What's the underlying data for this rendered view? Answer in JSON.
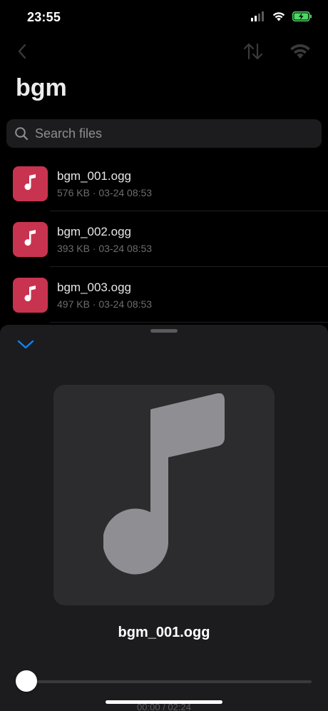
{
  "status_bar": {
    "time": "23:55",
    "icons": [
      "cellular-signal-icon",
      "wifi-icon",
      "battery-charging-icon"
    ],
    "battery_color": "#4cd964"
  },
  "nav": {
    "back_icon": "chevron-left-icon",
    "actions": [
      "sort-arrows-icon",
      "wifi-transfer-icon"
    ]
  },
  "page": {
    "title": "bgm"
  },
  "search": {
    "placeholder": "Search files",
    "value": ""
  },
  "files": [
    {
      "name": "bgm_001.ogg",
      "meta": "576 KB · 03-24 08:53",
      "icon": "music-note-icon"
    },
    {
      "name": "bgm_002.ogg",
      "meta": "393 KB · 03-24 08:53",
      "icon": "music-note-icon"
    },
    {
      "name": "bgm_003.ogg",
      "meta": "497 KB · 03-24 08:53",
      "icon": "music-note-icon"
    }
  ],
  "player": {
    "collapse_icon": "chevron-down-icon",
    "artwork_icon": "music-note-icon",
    "track_title": "bgm_001.ogg",
    "progress_fraction": 0,
    "time_readout": "00:00 / 02:24"
  },
  "colors": {
    "accent": "#0a84ff",
    "file_thumb": "#c8344f",
    "background": "#000000",
    "sheet": "#1c1c1e"
  }
}
